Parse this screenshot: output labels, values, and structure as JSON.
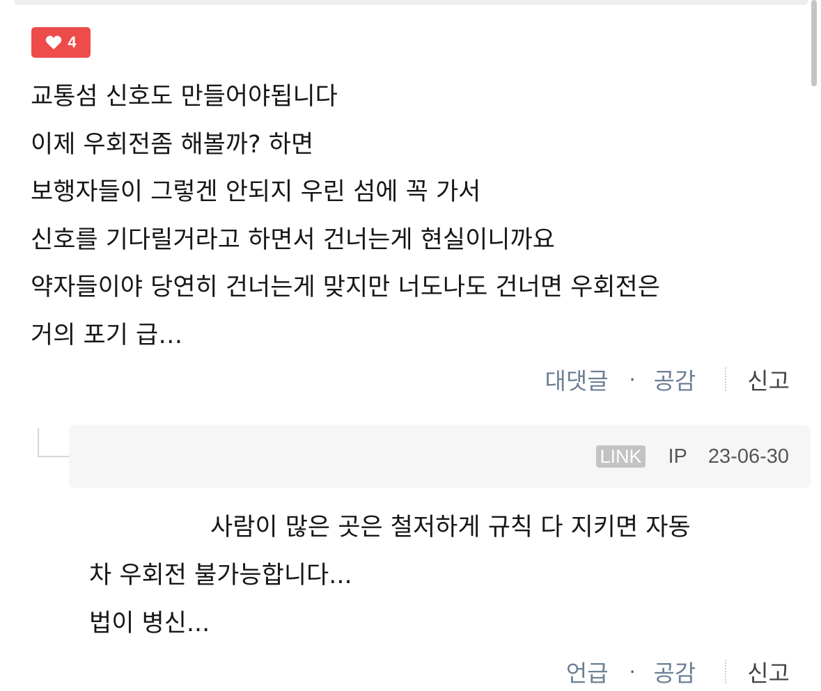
{
  "comment": {
    "likes": "4",
    "lines": [
      "교통섬 신호도 만들어야됩니다",
      "이제 우회전좀 해볼까? 하면",
      "보행자들이 그렇겐 안되지 우린 섬에 꼭 가서",
      "신호를 기다릴거라고 하면서 건너는게 현실이니까요",
      "약자들이야 당연히 건너는게 맞지만 너도나도 건너면 우회전은",
      "거의 포기 급…"
    ],
    "actions": {
      "reply": "대댓글",
      "dot": "·",
      "empathy": "공감",
      "report": "신고"
    }
  },
  "reply": {
    "link_badge": "LINK",
    "ip": "IP",
    "date": "23-06-30",
    "lines": [
      "사람이 많은 곳은 철저하게 규칙 다 지키면 자동",
      "차 우회전 불가능합니다...",
      "법이 병신..."
    ],
    "actions": {
      "mention": "언급",
      "dot": "·",
      "empathy": "공감",
      "report": "신고"
    }
  },
  "colors": {
    "like_badge": "#ee4b4b",
    "action_link": "#6b7f95",
    "link_badge": "#c3c3c3"
  }
}
